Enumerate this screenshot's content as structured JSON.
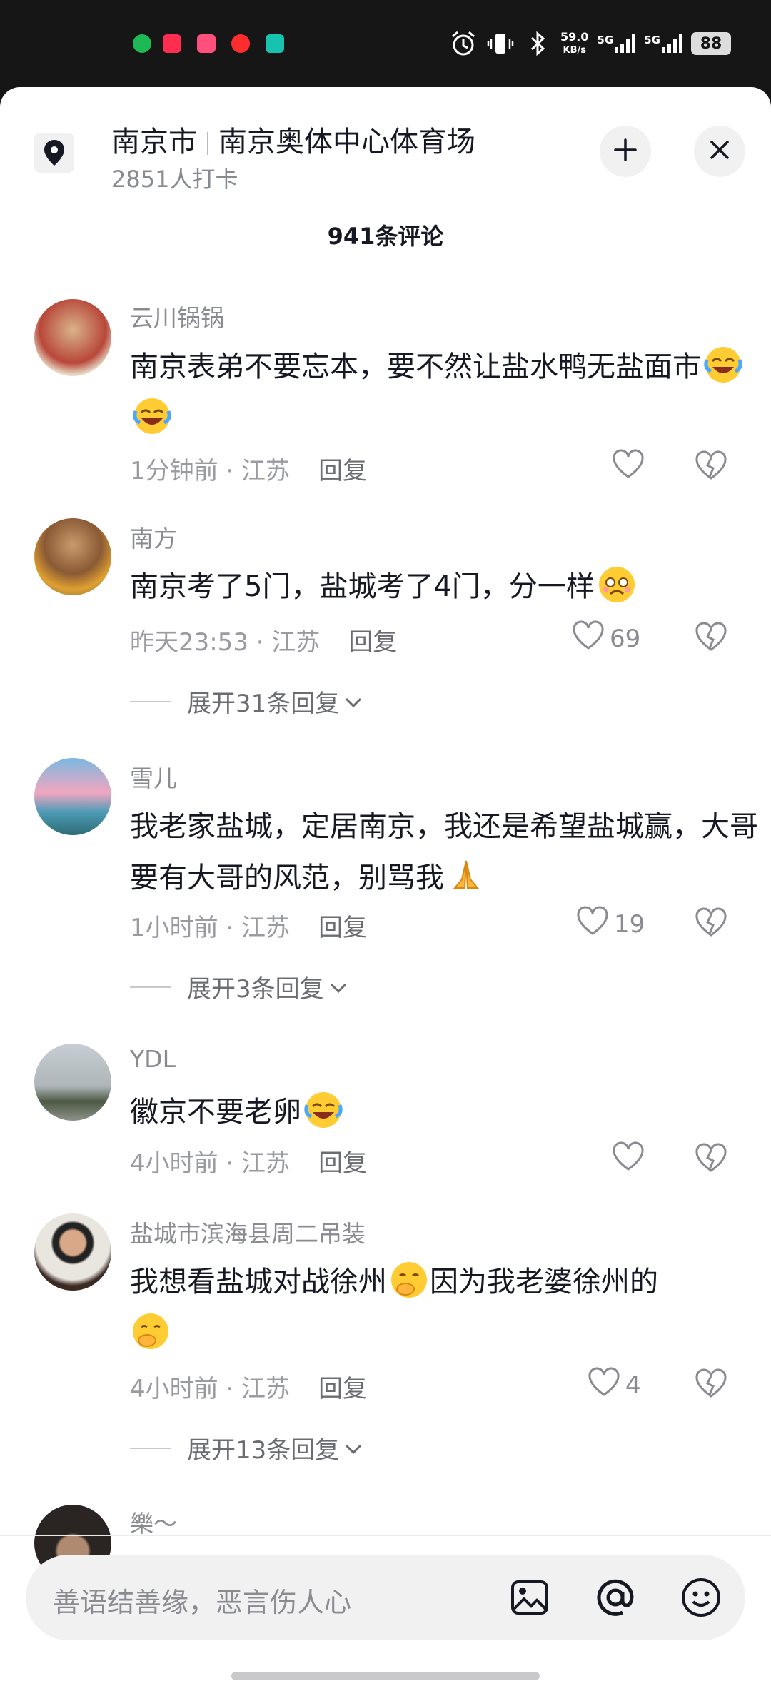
{
  "status_bar": {
    "net_speed_value": "59.0",
    "net_speed_unit": "KB/s",
    "sim1": "5G",
    "sim2": "5G",
    "battery": "88"
  },
  "header": {
    "city": "南京市",
    "venue": "南京奥体中心体育场",
    "checkins": "2851人打卡",
    "comment_count": "941条评论"
  },
  "comments": [
    {
      "name": "云川锅锅",
      "text": "南京表弟不要忘本，要不然让盐水鸭无盐面市",
      "time": "1分钟前 · 江苏",
      "reply": "回复",
      "likes": ""
    },
    {
      "name": "南方",
      "text": "南京考了5门，盐城考了4门，分一样",
      "time": "昨天23:53 · 江苏",
      "reply": "回复",
      "likes": "69",
      "expand": "展开31条回复"
    },
    {
      "name": "雪儿",
      "text": "我老家盐城，定居南京，我还是希望盐城赢，大哥要有大哥的风范，别骂我",
      "time": "1小时前 · 江苏",
      "reply": "回复",
      "likes": "19",
      "expand": "展开3条回复"
    },
    {
      "name": "YDL",
      "text": "徽京不要老卵",
      "time": "4小时前 · 江苏",
      "reply": "回复",
      "likes": ""
    },
    {
      "name": "盐城市滨海县周二吊装",
      "text_a": "我想看盐城对战徐州",
      "text_b": "因为我老婆徐州的",
      "time": "4小时前 · 江苏",
      "reply": "回复",
      "likes": "4",
      "expand": "展开13条回复"
    },
    {
      "name": "樂～"
    }
  ],
  "input": {
    "placeholder": "善语结善缘，恶言伤人心"
  },
  "icons": [
    "location-pin-icon",
    "collapse-icon",
    "close-icon",
    "heart-icon",
    "broken-heart-icon",
    "chevron-down-icon",
    "image-icon",
    "at-icon",
    "emoji-icon"
  ]
}
